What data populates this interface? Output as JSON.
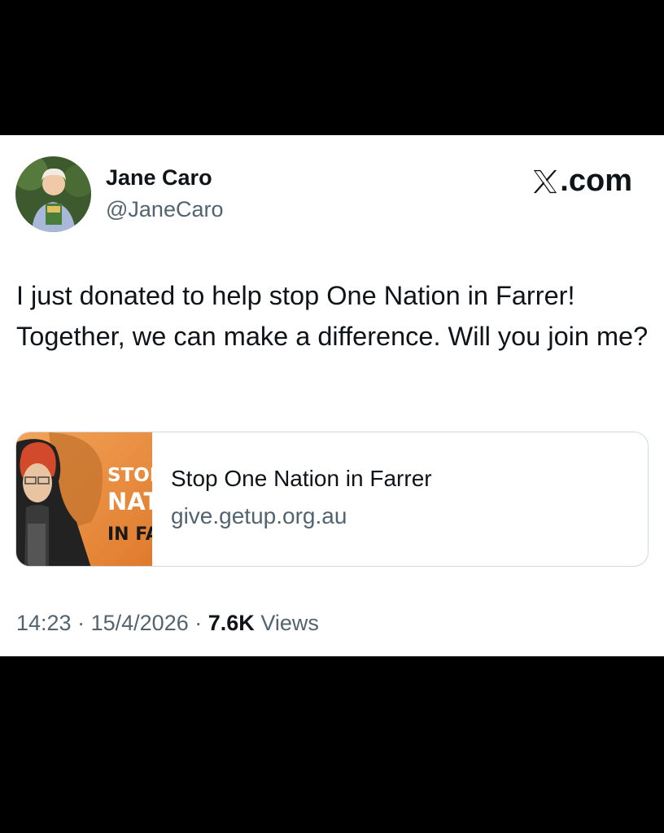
{
  "tweet": {
    "author_name": "Jane Caro",
    "author_handle": "@JaneCaro",
    "brand": ".com",
    "brand_icon": "x-logo-icon",
    "text": "I just donated to help stop One Nation in Farrer! Together, we can make a difference. Will you join me?",
    "link_card": {
      "title": "Stop One Nation in Farrer",
      "domain": "give.getup.org.au",
      "thumb_text": [
        "STOP",
        "NAT",
        "IN FA"
      ]
    },
    "time": "14:23",
    "date": "15/4/2026",
    "separator": "·",
    "views_count": "7.6K",
    "views_label": "Views"
  },
  "colors": {
    "background": "#000000",
    "card": "#ffffff",
    "primary_text": "#0f1419",
    "secondary_text": "#536471",
    "border": "#cfd9de",
    "thumb_orange": "#e8893a"
  }
}
